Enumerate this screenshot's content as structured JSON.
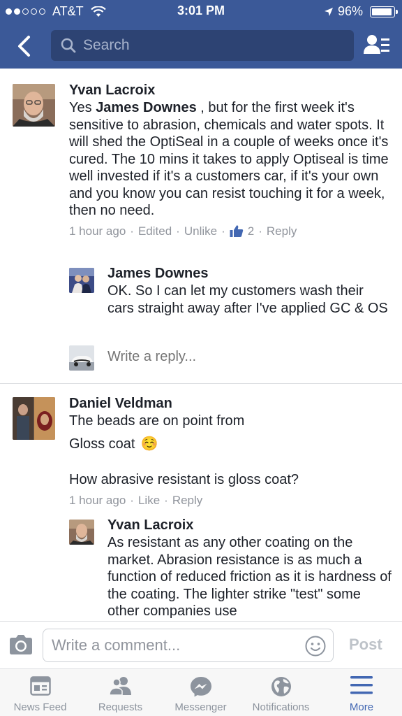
{
  "status_bar": {
    "carrier": "AT&T",
    "time": "3:01 PM",
    "battery": "96%",
    "battery_level": 0.96,
    "signal_bars_filled": 2,
    "signal_bars_total": 5
  },
  "header": {
    "search_placeholder": "Search",
    "icons": [
      "back-chevron-icon",
      "search-icon",
      "friends-list-icon"
    ]
  },
  "comments": [
    {
      "author": "Yvan Lacroix",
      "text_prefix": "Yes ",
      "mention": "James Downes",
      "text_suffix": " , but for the first week it's sensitive to abrasion, chemicals and water spots. It will shed the OptiSeal in a couple of weeks once it's cured. The 10 mins it takes to apply Optiseal is time well invested if it's a customers car, if it's your own and you know you can resist touching it for a week, then no need.",
      "time": "1 hour ago",
      "edited": "Edited",
      "action": "Unlike",
      "like_count": "2",
      "reply": "Reply",
      "replies": [
        {
          "author": "James Downes",
          "text": "OK. So I can let my customers wash their cars straight away after I've applied GC & OS"
        }
      ],
      "write_reply_placeholder": "Write a reply..."
    },
    {
      "author": "Daniel Veldman",
      "line1": "The beads are on point from",
      "line2": "Gloss coat",
      "emoji": "☺️",
      "line3": "How abrasive resistant is gloss coat?",
      "time": "1 hour ago",
      "action": "Like",
      "reply": "Reply",
      "replies": [
        {
          "author": "Yvan Lacroix",
          "text": "As resistant as any other coating on the market. Abrasion resistance is as much a function of reduced friction as it is hardness of the coating. The lighter strike \"test\" some other companies use"
        }
      ]
    }
  ],
  "composer": {
    "placeholder": "Write a comment...",
    "post_label": "Post"
  },
  "tabs": [
    {
      "label": "News Feed",
      "icon": "news-feed-icon",
      "active": false
    },
    {
      "label": "Requests",
      "icon": "requests-icon",
      "active": false
    },
    {
      "label": "Messenger",
      "icon": "messenger-icon",
      "active": false
    },
    {
      "label": "Notifications",
      "icon": "notifications-globe-icon",
      "active": false
    },
    {
      "label": "More",
      "icon": "more-menu-icon",
      "active": true
    }
  ],
  "colors": {
    "brand_blue": "#3b5998",
    "search_bg": "#2d4373",
    "link_blue": "#4267b2",
    "meta_gray": "#90949c"
  }
}
